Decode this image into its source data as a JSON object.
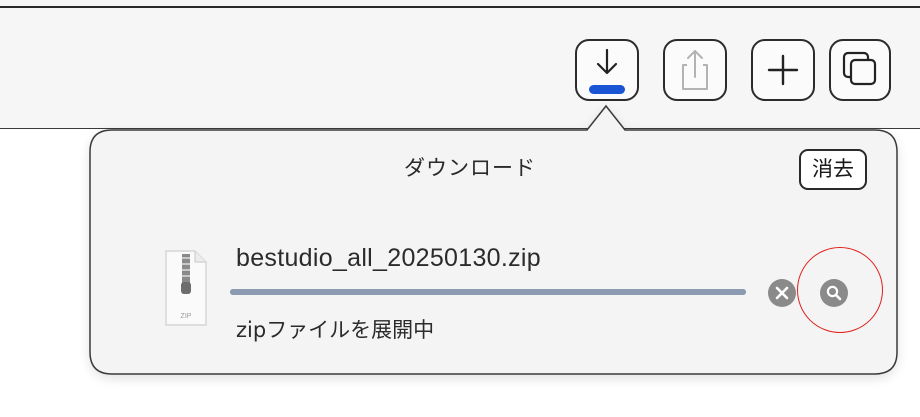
{
  "toolbar": {
    "buttons": [
      {
        "name": "download",
        "icon": "download-arrow-icon",
        "active": true
      },
      {
        "name": "share",
        "icon": "share-icon",
        "active": false
      },
      {
        "name": "new-tab",
        "icon": "plus-icon",
        "active": true
      },
      {
        "name": "tab-overview",
        "icon": "tabs-overview-icon",
        "active": true
      }
    ],
    "download_progress_color": "#1a55d6"
  },
  "downloads_popover": {
    "title": "ダウンロード",
    "clear_label": "消去",
    "items": [
      {
        "file_name": "bestudio_all_20250130.zip",
        "file_icon": "zip-file-icon",
        "file_icon_label": "ZIP",
        "status": "zipファイルを展開中",
        "progress": 1.0,
        "actions": [
          {
            "name": "cancel",
            "icon": "close-icon"
          },
          {
            "name": "reveal-in-finder",
            "icon": "magnifier-icon"
          }
        ]
      }
    ]
  },
  "annotation": {
    "shape": "circle",
    "color": "#e0201a",
    "target": "reveal-in-finder"
  }
}
